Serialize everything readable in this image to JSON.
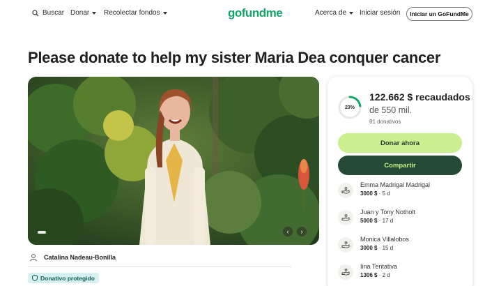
{
  "nav": {
    "search_label": "Buscar",
    "donate_label": "Donar",
    "fundraise_label": "Recolectar fondos",
    "logo": "gofundme",
    "about_label": "Acerca de",
    "signin_label": "Iniciar sesión",
    "start_label": "Iniciar un GoFundMe"
  },
  "campaign": {
    "title": "Please donate to help my sister Maria Dea conquer cancer",
    "organizer": "Catalina Nadeau-Bonilla",
    "protected_badge": "Donativo protegido"
  },
  "donation": {
    "percent_label": "23%",
    "percent_value": 0.23,
    "raised": "122.662 $ recaudados",
    "goal": "de 550 mil.",
    "count": "81 donativos",
    "donate_button": "Donar ahora",
    "share_button": "Compartir",
    "accent_color": "#c9ef8e",
    "dark_color": "#254b36"
  },
  "donors": [
    {
      "name": "Emma Madrigal Madrigal",
      "amount": "3000 $",
      "time": " · 5 d"
    },
    {
      "name": "Juan y Tony Notholt",
      "amount": "5000 $",
      "time": " · 17 d"
    },
    {
      "name": "Monica Villalobos",
      "amount": "3000 $",
      "time": " · 15 d"
    },
    {
      "name": "Iina Tentativa",
      "amount": "1306 $",
      "time": " · 2 d"
    }
  ]
}
